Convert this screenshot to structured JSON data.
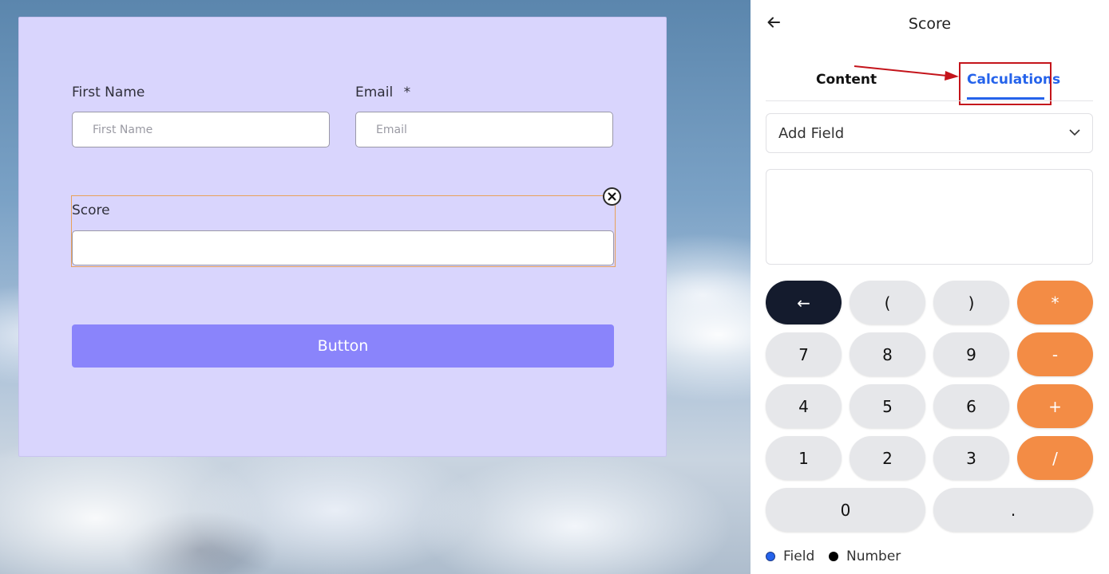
{
  "form": {
    "first_name_label": "First Name",
    "first_name_placeholder": "First Name",
    "email_label": "Email",
    "email_required": "*",
    "email_placeholder": "Email",
    "score_label": "Score",
    "score_value": "",
    "close_icon": "close-circle-icon",
    "button_label": "Button"
  },
  "panel": {
    "back_icon": "arrow-left-icon",
    "title": "Score",
    "tabs": [
      {
        "label": "Content",
        "active": false
      },
      {
        "label": "Calculations",
        "active": true
      }
    ],
    "add_field_label": "Add Field",
    "formula_value": "",
    "keypad": {
      "backspace": "←",
      "open_paren": "(",
      "close_paren": ")",
      "multiply": "*",
      "seven": "7",
      "eight": "8",
      "nine": "9",
      "minus": "-",
      "four": "4",
      "five": "5",
      "six": "6",
      "plus": "+",
      "one": "1",
      "two": "2",
      "three": "3",
      "divide": "/",
      "zero": "0",
      "decimal": "."
    },
    "legend": [
      {
        "label": "Field",
        "color": "#2563eb"
      },
      {
        "label": "Number",
        "color": "#000000"
      }
    ]
  },
  "colors": {
    "accent": "#2563eb",
    "operator": "#f38c45",
    "backspace": "#141b2d",
    "form_bg": "#d9d5fd",
    "button": "#8a84fb",
    "annotation": "#c4141b"
  }
}
